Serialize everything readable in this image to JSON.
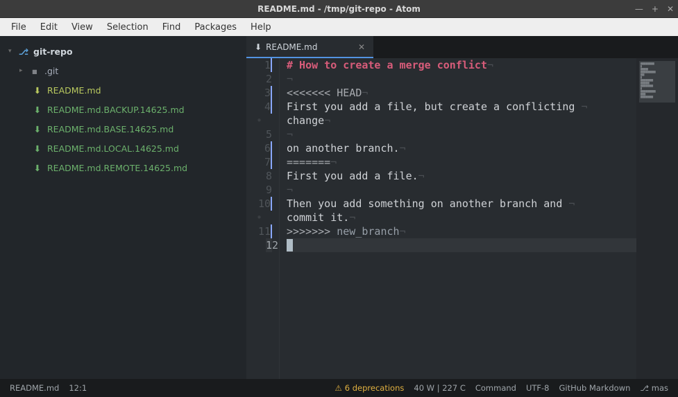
{
  "window": {
    "title": "README.md - /tmp/git-repo - Atom"
  },
  "menu": [
    "File",
    "Edit",
    "View",
    "Selection",
    "Find",
    "Packages",
    "Help"
  ],
  "tree": {
    "root": "git-repo",
    "git_folder": ".git",
    "files": [
      {
        "name": "README.md",
        "status": "modified",
        "selected": true
      },
      {
        "name": "README.md.BACKUP.14625.md",
        "status": "added"
      },
      {
        "name": "README.md.BASE.14625.md",
        "status": "added"
      },
      {
        "name": "README.md.LOCAL.14625.md",
        "status": "added"
      },
      {
        "name": "README.md.REMOTE.14625.md",
        "status": "added"
      }
    ]
  },
  "tab": {
    "title": "README.md"
  },
  "editor": {
    "gutter": [
      "1",
      "2",
      "3",
      "4",
      "•",
      "5",
      "6",
      "7",
      "8",
      "9",
      "10",
      "•",
      "11",
      "12"
    ],
    "cursor_gutter_index": 13,
    "lines": [
      {
        "t": "head",
        "text": "# How to create a merge conflict"
      },
      {
        "t": "blank",
        "text": ""
      },
      {
        "t": "conf",
        "text": "<<<<<<< HEAD"
      },
      {
        "t": "plain",
        "text": "First you add a file, but create a conflicting "
      },
      {
        "t": "wrap",
        "text": "change"
      },
      {
        "t": "blank",
        "text": ""
      },
      {
        "t": "plain",
        "text": "on another branch."
      },
      {
        "t": "conf",
        "text": "======="
      },
      {
        "t": "plain",
        "text": "First you add a file."
      },
      {
        "t": "blank",
        "text": ""
      },
      {
        "t": "plain",
        "text": "Then you add something on another branch and "
      },
      {
        "t": "wrap",
        "text": "commit it."
      },
      {
        "t": "branch",
        "parts": [
          ">>>>>>> ",
          "new_branch"
        ]
      },
      {
        "t": "cursor",
        "text": ""
      }
    ]
  },
  "status": {
    "file": "README.md",
    "pos": "12:1",
    "deprecations": "6 deprecations",
    "linelen": "40 W | 227 C",
    "mode": "Command",
    "encoding": "UTF-8",
    "grammar": "GitHub Markdown",
    "branch": "mas"
  }
}
